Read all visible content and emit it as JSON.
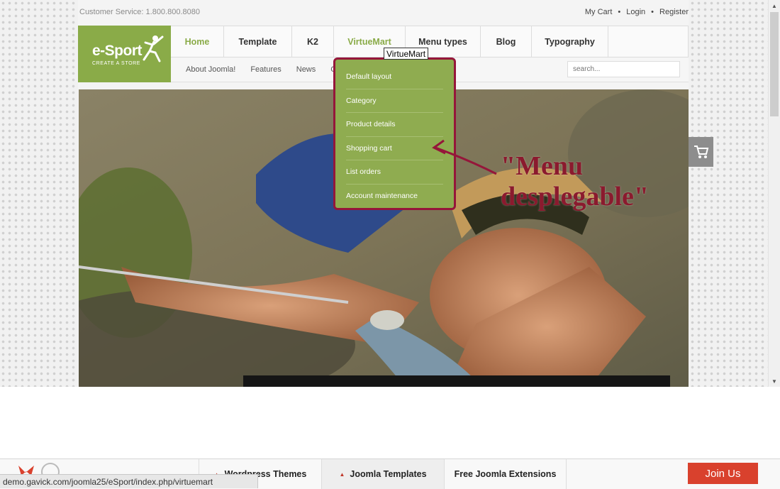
{
  "topbar": {
    "customer_service": "Customer Service: 1.800.800.8080",
    "links": [
      "My Cart",
      "Login",
      "Register"
    ]
  },
  "logo": {
    "title": "e-Sport",
    "subtitle": "CREATE A STORE"
  },
  "nav": {
    "items": [
      "Home",
      "Template",
      "K2",
      "VirtueMart",
      "Menu types",
      "Blog",
      "Typography"
    ],
    "hovered": "VirtueMart"
  },
  "subnav": {
    "items": [
      "About Joomla!",
      "Features",
      "News",
      "C"
    ]
  },
  "search": {
    "placeholder": "search..."
  },
  "tooltip": {
    "text": "VirtueMart"
  },
  "dropdown": {
    "items": [
      "Default layout",
      "Category",
      "Product details",
      "Shopping cart",
      "List orders",
      "Account maintenance"
    ]
  },
  "annotation": {
    "line1": "\"Menu",
    "line2": "desplegable\""
  },
  "footer": {
    "tabs": [
      "Wordpress Themes",
      "Joomla Templates",
      "Free Joomla Extensions"
    ],
    "active_tab": "Joomla Templates",
    "join_label": "Join Us"
  },
  "statusbar": {
    "url": "demo.gavick.com/joomla25/eSport/index.php/virtuemart"
  },
  "colors": {
    "brand_green": "#8aab48",
    "annotation": "#8b1a2e",
    "join": "#d9412d"
  },
  "icons": {
    "cart": "shopping-cart-icon",
    "logo": "climber-figure-icon"
  }
}
